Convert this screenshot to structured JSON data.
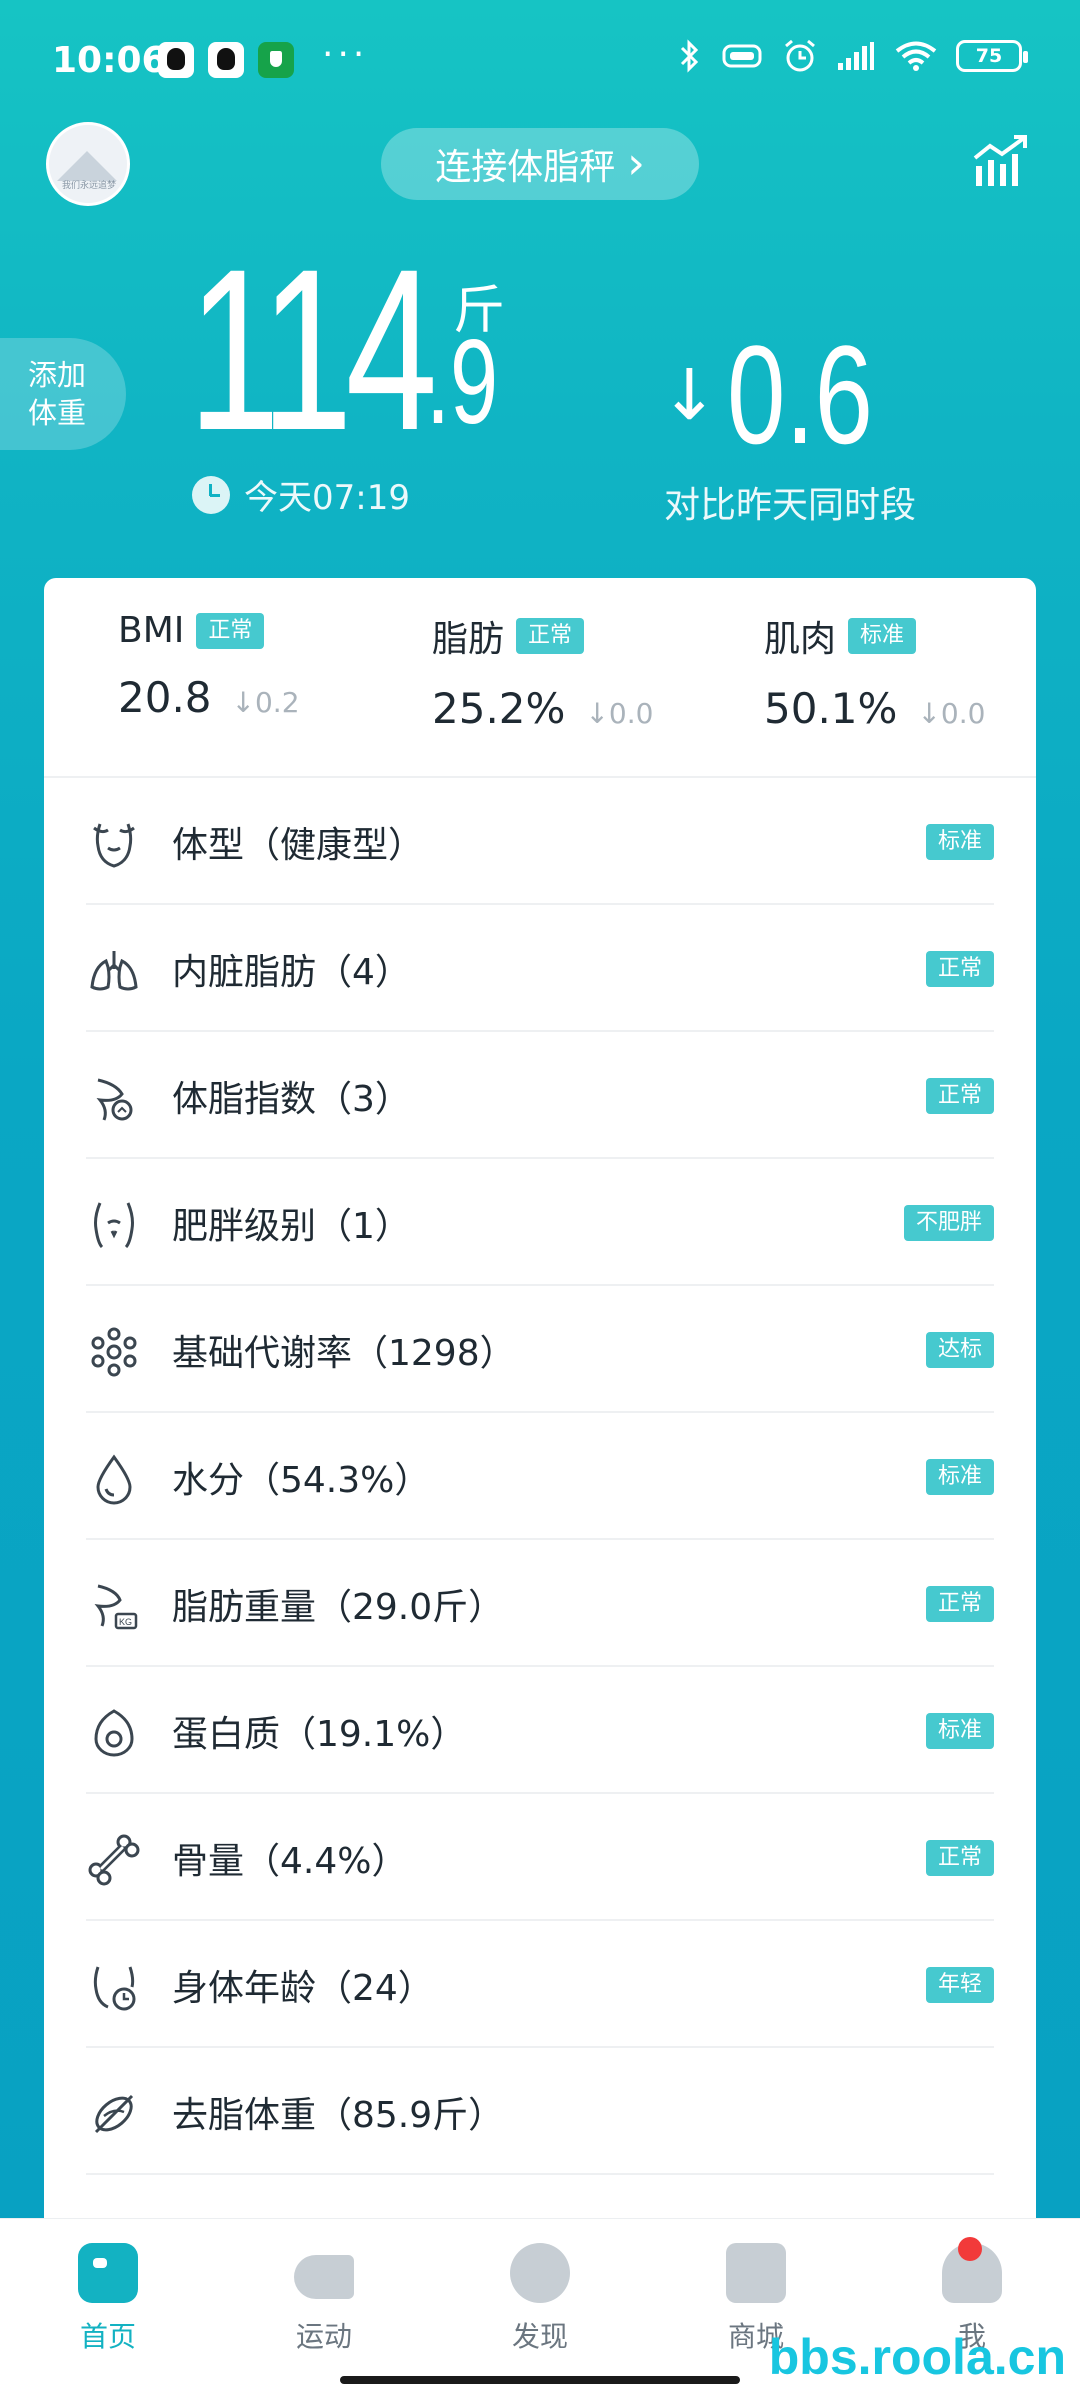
{
  "status_bar": {
    "time": "10:06",
    "dots": "···",
    "battery": "75"
  },
  "header": {
    "avatar_caption": "我们永远追梦",
    "connect_label": "连接体脂秤",
    "connect_chevron": "›",
    "add_weight_line1": "添加",
    "add_weight_line2": "体重"
  },
  "weight": {
    "integer": "114",
    "decimal": ".9",
    "unit": "斤",
    "time": "今天07:19",
    "change_arrow": "↓",
    "change_value": "0.6",
    "change_caption": "对比昨天同时段"
  },
  "metrics": [
    {
      "name": "BMI",
      "tag": "正常",
      "value": "20.8",
      "delta": "↓0.2"
    },
    {
      "name": "脂肪",
      "tag": "正常",
      "value": "25.2%",
      "delta": "↓0.0"
    },
    {
      "name": "肌肉",
      "tag": "标准",
      "value": "50.1%",
      "delta": "↓0.0"
    }
  ],
  "items": [
    {
      "icon": "body-type-icon",
      "label": "体型（健康型）",
      "tag": "标准"
    },
    {
      "icon": "lungs-icon",
      "label": "内脏脂肪（4）",
      "tag": "正常"
    },
    {
      "icon": "body-fat-index-icon",
      "label": "体脂指数（3）",
      "tag": "正常"
    },
    {
      "icon": "torso-icon",
      "label": "肥胖级别（1）",
      "tag": "不肥胖"
    },
    {
      "icon": "metabolism-icon",
      "label": "基础代谢率（1298）",
      "tag": "达标"
    },
    {
      "icon": "water-drop-icon",
      "label": "水分（54.3%）",
      "tag": "标准"
    },
    {
      "icon": "fat-weight-icon",
      "label": "脂肪重量（29.0斤）",
      "tag": "正常"
    },
    {
      "icon": "egg-icon",
      "label": "蛋白质（19.1%）",
      "tag": "标准"
    },
    {
      "icon": "bone-icon",
      "label": "骨量（4.4%）",
      "tag": "正常"
    },
    {
      "icon": "body-age-icon",
      "label": "身体年龄（24）",
      "tag": "年轻"
    },
    {
      "icon": "lean-weight-icon",
      "label": "去脂体重（85.9斤）",
      "tag": ""
    }
  ],
  "nav": [
    {
      "label": "首页"
    },
    {
      "label": "运动"
    },
    {
      "label": "发现"
    },
    {
      "label": "商城"
    },
    {
      "label": "我"
    }
  ],
  "watermark": "bbs.roola.cn",
  "colors": {
    "accent": "#13b2c2",
    "tag": "#46c9cf",
    "header_gradient_top": "#16c4c4",
    "header_gradient_bottom": "#08a0c2"
  }
}
